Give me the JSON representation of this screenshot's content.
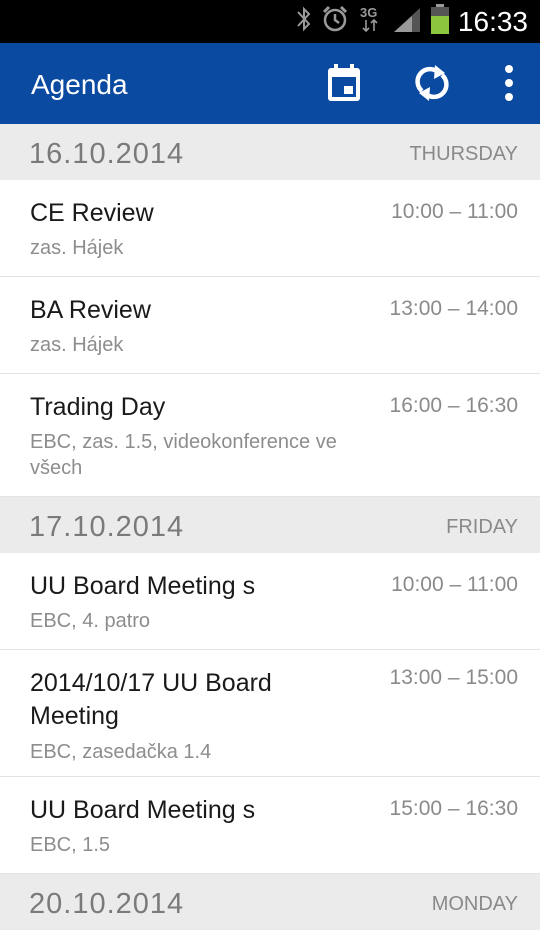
{
  "status_bar": {
    "time": "16:33",
    "network": "3G",
    "icons": [
      "bluetooth-icon",
      "alarm-icon",
      "3g-data-icon",
      "signal-icon",
      "battery-icon"
    ]
  },
  "action_bar": {
    "title": "Agenda",
    "actions": [
      "calendar-icon",
      "sync-icon",
      "overflow-menu-icon"
    ],
    "color": "#0a4aa0"
  },
  "days": [
    {
      "date": "16.10.2014",
      "weekday": "THURSDAY",
      "events": [
        {
          "title": "CE Review",
          "location": "zas. Hájek",
          "time": "10:00 – 11:00"
        },
        {
          "title": "BA Review",
          "location": "zas. Hájek",
          "time": "13:00 – 14:00"
        },
        {
          "title": "Trading Day",
          "location": "EBC, zas. 1.5, videokonference ve všech",
          "time": "16:00 – 16:30"
        }
      ]
    },
    {
      "date": "17.10.2014",
      "weekday": "FRIDAY",
      "events": [
        {
          "title": "UU Board Meeting s",
          "location": "EBC, 4. patro",
          "time": "10:00 – 11:00"
        },
        {
          "title": "2014/10/17 UU Board Meeting",
          "location": "EBC, zasedačka 1.4",
          "time": "13:00 – 15:00"
        },
        {
          "title": "UU Board Meeting s",
          "location": "EBC, 1.5",
          "time": "15:00 – 16:30"
        }
      ]
    },
    {
      "date": "20.10.2014",
      "weekday": "MONDAY",
      "events": []
    }
  ]
}
